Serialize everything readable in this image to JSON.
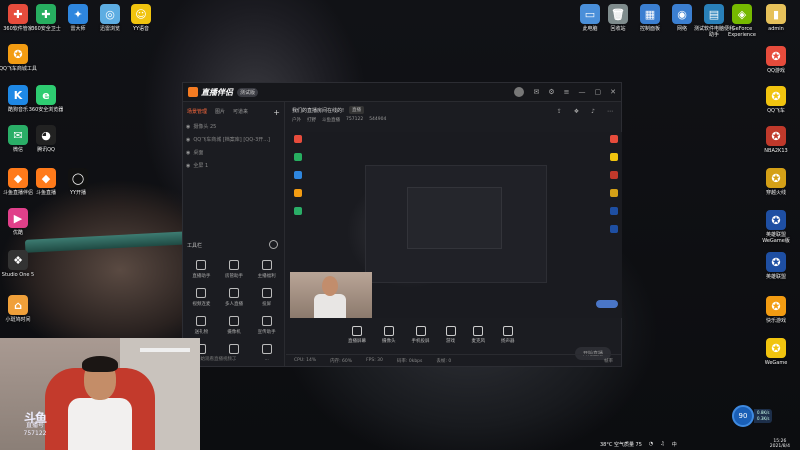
{
  "desktop_icons_left": [
    {
      "label": "360软件管家",
      "color": "#e74c3c",
      "glyph": "✚"
    },
    {
      "label": "360安全卫士",
      "color": "#27ae60",
      "glyph": "✚"
    },
    {
      "label": "雷大师",
      "color": "#2e86de",
      "glyph": "✦"
    },
    {
      "label": "迅雷浏览",
      "color": "#5dade2",
      "glyph": "◎"
    },
    {
      "label": "YY语音",
      "color": "#f1c40f",
      "glyph": "☺"
    },
    {
      "label": "QQ飞车商城工具",
      "color": "#f39c12",
      "glyph": "✪"
    },
    {
      "label": "酷狗音乐",
      "color": "#1e88e5",
      "glyph": "K"
    },
    {
      "label": "360安全浏览器",
      "color": "#2ecc71",
      "glyph": "e"
    },
    {
      "label": "微信",
      "color": "#2aae67",
      "glyph": "✉"
    },
    {
      "label": "腾讯QQ",
      "color": "#222",
      "glyph": "◕"
    },
    {
      "label": "斗鱼直播伴侣",
      "color": "#ff7a1a",
      "glyph": "◆"
    },
    {
      "label": "斗鱼直播",
      "color": "#ff7a1a",
      "glyph": "◆"
    },
    {
      "label": "YY开播",
      "color": "#111",
      "glyph": "◯"
    },
    {
      "label": "优酷",
      "color": "#e0408a",
      "glyph": "▶"
    },
    {
      "label": "Studio One 5",
      "color": "#333",
      "glyph": "❖"
    },
    {
      "label": "小斑鸠时间",
      "color": "#f0a03a",
      "glyph": "⌂"
    }
  ],
  "desktop_icons_right_top": [
    {
      "label": "此电脑",
      "color": "#4a8fd9",
      "glyph": "▭"
    },
    {
      "label": "回收站",
      "color": "#7f8c8d",
      "glyph": "🗑"
    },
    {
      "label": "控制面板",
      "color": "#3b7fd1",
      "glyph": "▦"
    },
    {
      "label": "网络",
      "color": "#3b7fd1",
      "glyph": "◉"
    },
    {
      "label": "测试软件电脑便利助手",
      "color": "#2980b9",
      "glyph": "▤"
    },
    {
      "label": "GeForce Experience",
      "color": "#76b900",
      "glyph": "◈"
    },
    {
      "label": "admin",
      "color": "#e6c15a",
      "glyph": "▮"
    }
  ],
  "desktop_icons_right_col": [
    {
      "label": "QQ游戏",
      "color": "#e74c3c",
      "glyph": "✪"
    },
    {
      "label": "QQ飞车",
      "color": "#f1c40f",
      "glyph": "✪"
    },
    {
      "label": "NBA2K13",
      "color": "#c0392b",
      "glyph": "✪"
    },
    {
      "label": "穿越火线",
      "color": "#d4a017",
      "glyph": "✪"
    },
    {
      "label": "英雄联盟 WeGame版",
      "color": "#1e4fa3",
      "glyph": "✪"
    },
    {
      "label": "英雄联盟",
      "color": "#1e4fa3",
      "glyph": "✪"
    },
    {
      "label": "快乐游戏",
      "color": "#f39c12",
      "glyph": "✪"
    },
    {
      "label": "WeGame",
      "color": "#f1c40f",
      "glyph": "✪"
    }
  ],
  "app": {
    "name": "直播伴侣",
    "version_badge": "测试版",
    "left_tabs": [
      "场景管理",
      "图片",
      "可道来"
    ],
    "scenes": [
      {
        "label": "摄像头 25"
      },
      {
        "label": "QQ飞车商城 [档案库] [QQ-3开...]"
      },
      {
        "label": "桌面"
      },
      {
        "label": "全屏 1"
      }
    ],
    "tools_title": "工具栏",
    "tools": [
      "直播助手",
      "房管助手",
      "主播福利",
      "视频连麦",
      "多人直播",
      "投屏",
      "送礼物",
      "摄像机",
      "宣传助手",
      "...",
      "...",
      "..."
    ],
    "left_footer": "已经开始观看直播视频了",
    "room_title": "我们的直播房间在线的!",
    "room_badge": "直播",
    "room_meta": [
      "户外",
      "打野",
      "斗鱼直播",
      "757122",
      "544904"
    ],
    "bottom_tools": [
      "直播屏幕",
      "摄像头",
      "手机投屏",
      "游戏",
      "麦克风",
      "扬声器"
    ],
    "start_button": "开始直播",
    "status": [
      "CPU: 14%",
      "内存: 60%",
      "FPS: 30",
      "码率: 0kbps",
      "丢帧: 0"
    ],
    "status_right": "帧率"
  },
  "webcam": {
    "logo_main": "斗鱼",
    "logo_sub": "直播号",
    "room_id": "757122"
  },
  "speed_widget": {
    "value": "90",
    "up": "0.8K/s",
    "down": "0.3K/s"
  },
  "tray": {
    "temp": "38°C 空气质量 75",
    "time": "15:26",
    "date": "2021/8/4"
  }
}
